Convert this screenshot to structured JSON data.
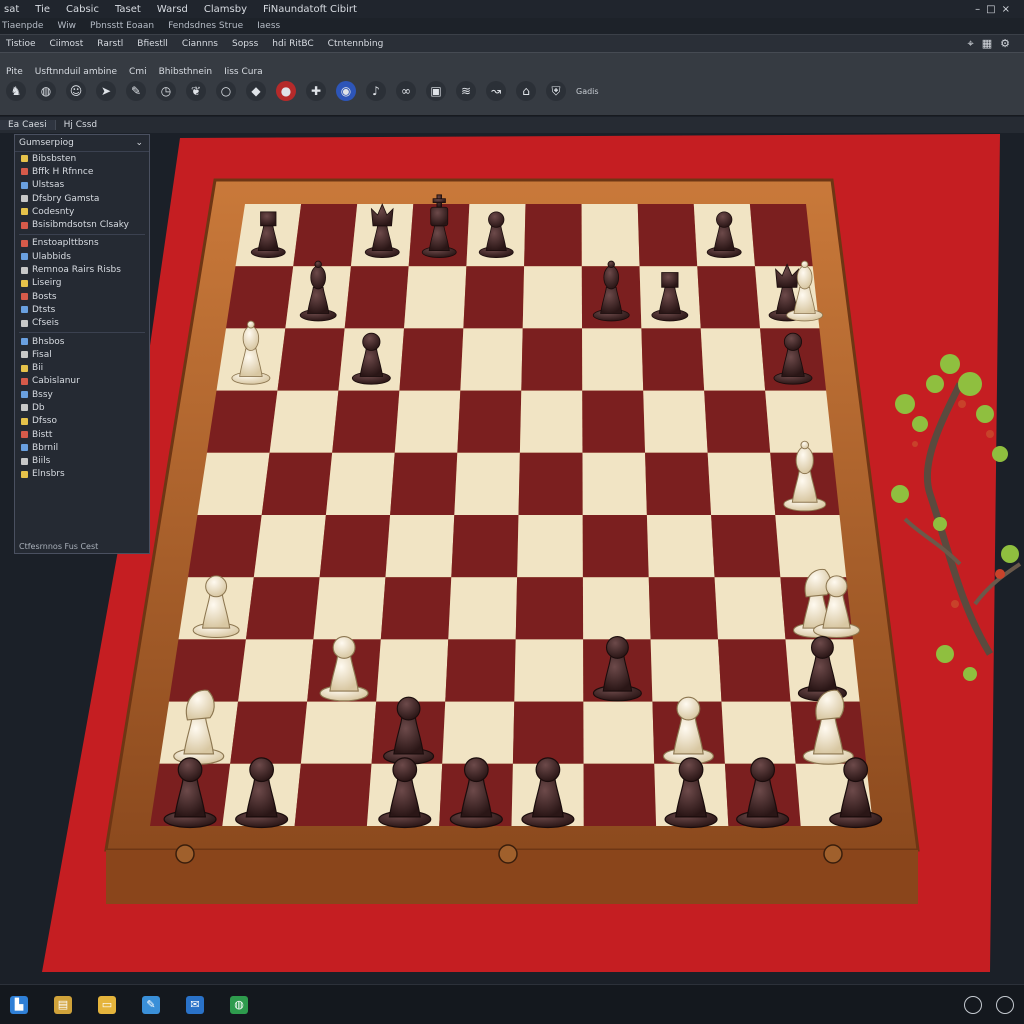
{
  "menubar": {
    "items": [
      "sat",
      "Tie",
      "Cabsic",
      "Taset",
      "Warsd",
      "Clamsby",
      "FiNaundatoft Cibirt"
    ]
  },
  "tabbar": {
    "items": [
      "Tiaenpde",
      "Wiw",
      "Pbnsstt Eoaan",
      "Fendsdnes Strue",
      "Iaess"
    ]
  },
  "ribbon": {
    "items": [
      "Tistioe",
      "Ciimost",
      "Rarstl",
      "Bfiestll",
      "Ciannns",
      "Sopss",
      "hdi RitBC",
      "Ctntennbing"
    ]
  },
  "toolbar": {
    "items": [
      "Pite",
      "Usftnnduil ambine",
      "Cmi",
      "Bhibsthnein",
      "Iiss Cura"
    ],
    "label": "Gadis"
  },
  "doc_tab": {
    "left": "Ea Caesi",
    "right": "Hj Cssd"
  },
  "panel": {
    "header": "Gumserpiog",
    "groups": [
      [
        "Bibsbsten",
        "Bffk H Rfnnce",
        "Ulstsas",
        "Dfsbry Gamsta",
        "Codesnty",
        "Bsisibmdsotsn Clsaky"
      ],
      [
        "Enstoaplttbsns",
        "Ulabbids",
        "Remnoa Rairs Risbs",
        "Liseirg",
        "Bosts",
        "Dtsts",
        "Cfseis"
      ],
      [
        "Bhsbos",
        "Fisal",
        "Bii",
        "Cabislanur",
        "Bssy",
        "Db",
        "Dfsso",
        "Bistt",
        "Bbrnil",
        "Biils",
        "Elnsbrs"
      ]
    ],
    "footer": "Ctfesrnnos Fus Cest"
  },
  "game": {
    "board_files": 10,
    "board_ranks": 10,
    "light_square": "#f1e4c4",
    "dark_square": "#7b1f1f",
    "frame": "#b8682a",
    "cloth": "#c51e22",
    "pieces": [
      {
        "type": "rook",
        "color": "dark",
        "file": 0,
        "rank": 0
      },
      {
        "type": "bishop",
        "color": "dark",
        "file": 1,
        "rank": 1
      },
      {
        "type": "queen",
        "color": "dark",
        "file": 2,
        "rank": 0
      },
      {
        "type": "king",
        "color": "dark",
        "file": 3,
        "rank": 0
      },
      {
        "type": "pawn",
        "color": "dark",
        "file": 4,
        "rank": 0
      },
      {
        "type": "bishop",
        "color": "dark",
        "file": 6,
        "rank": 1
      },
      {
        "type": "rook",
        "color": "dark",
        "file": 7,
        "rank": 1
      },
      {
        "type": "pawn",
        "color": "dark",
        "file": 8,
        "rank": 0
      },
      {
        "type": "queen",
        "color": "dark",
        "file": 9,
        "rank": 1
      },
      {
        "type": "bishop",
        "color": "light",
        "file": 10,
        "rank": 1
      },
      {
        "type": "pawn",
        "color": "dark",
        "file": 2,
        "rank": 2
      },
      {
        "type": "pawn",
        "color": "dark",
        "file": 9,
        "rank": 2
      },
      {
        "type": "bishop",
        "color": "light",
        "file": 0,
        "rank": 2
      },
      {
        "type": "bishop",
        "color": "light",
        "file": 9,
        "rank": 4
      },
      {
        "type": "pawn",
        "color": "light",
        "file": 0,
        "rank": 6
      },
      {
        "type": "knight",
        "color": "light",
        "file": 9,
        "rank": 6
      },
      {
        "type": "pawn",
        "color": "light",
        "file": 10,
        "rank": 6
      },
      {
        "type": "pawn",
        "color": "light",
        "file": 2,
        "rank": 7
      },
      {
        "type": "pawn",
        "color": "dark",
        "file": 6,
        "rank": 7
      },
      {
        "type": "pawn",
        "color": "dark",
        "file": 9,
        "rank": 7
      },
      {
        "type": "pawn",
        "color": "dark",
        "file": 3,
        "rank": 8
      },
      {
        "type": "pawn",
        "color": "light",
        "file": 7,
        "rank": 8
      },
      {
        "type": "knight",
        "color": "light",
        "file": 0,
        "rank": 8
      },
      {
        "type": "knight",
        "color": "light",
        "file": 9,
        "rank": 8
      },
      {
        "type": "pawn",
        "color": "dark",
        "file": 0,
        "rank": 9
      },
      {
        "type": "pawn",
        "color": "dark",
        "file": 1,
        "rank": 9
      },
      {
        "type": "pawn",
        "color": "dark",
        "file": 3,
        "rank": 9
      },
      {
        "type": "pawn",
        "color": "dark",
        "file": 4,
        "rank": 9
      },
      {
        "type": "pawn",
        "color": "dark",
        "file": 5,
        "rank": 9
      },
      {
        "type": "pawn",
        "color": "dark",
        "file": 7,
        "rank": 9
      },
      {
        "type": "pawn",
        "color": "dark",
        "file": 8,
        "rank": 9
      },
      {
        "type": "pawn",
        "color": "dark",
        "file": 10,
        "rank": 9
      }
    ]
  },
  "taskbar": {
    "icons": [
      "start-icon",
      "file-manager-icon",
      "folder-icon",
      "editor-icon",
      "mail-icon",
      "browser-icon"
    ]
  }
}
